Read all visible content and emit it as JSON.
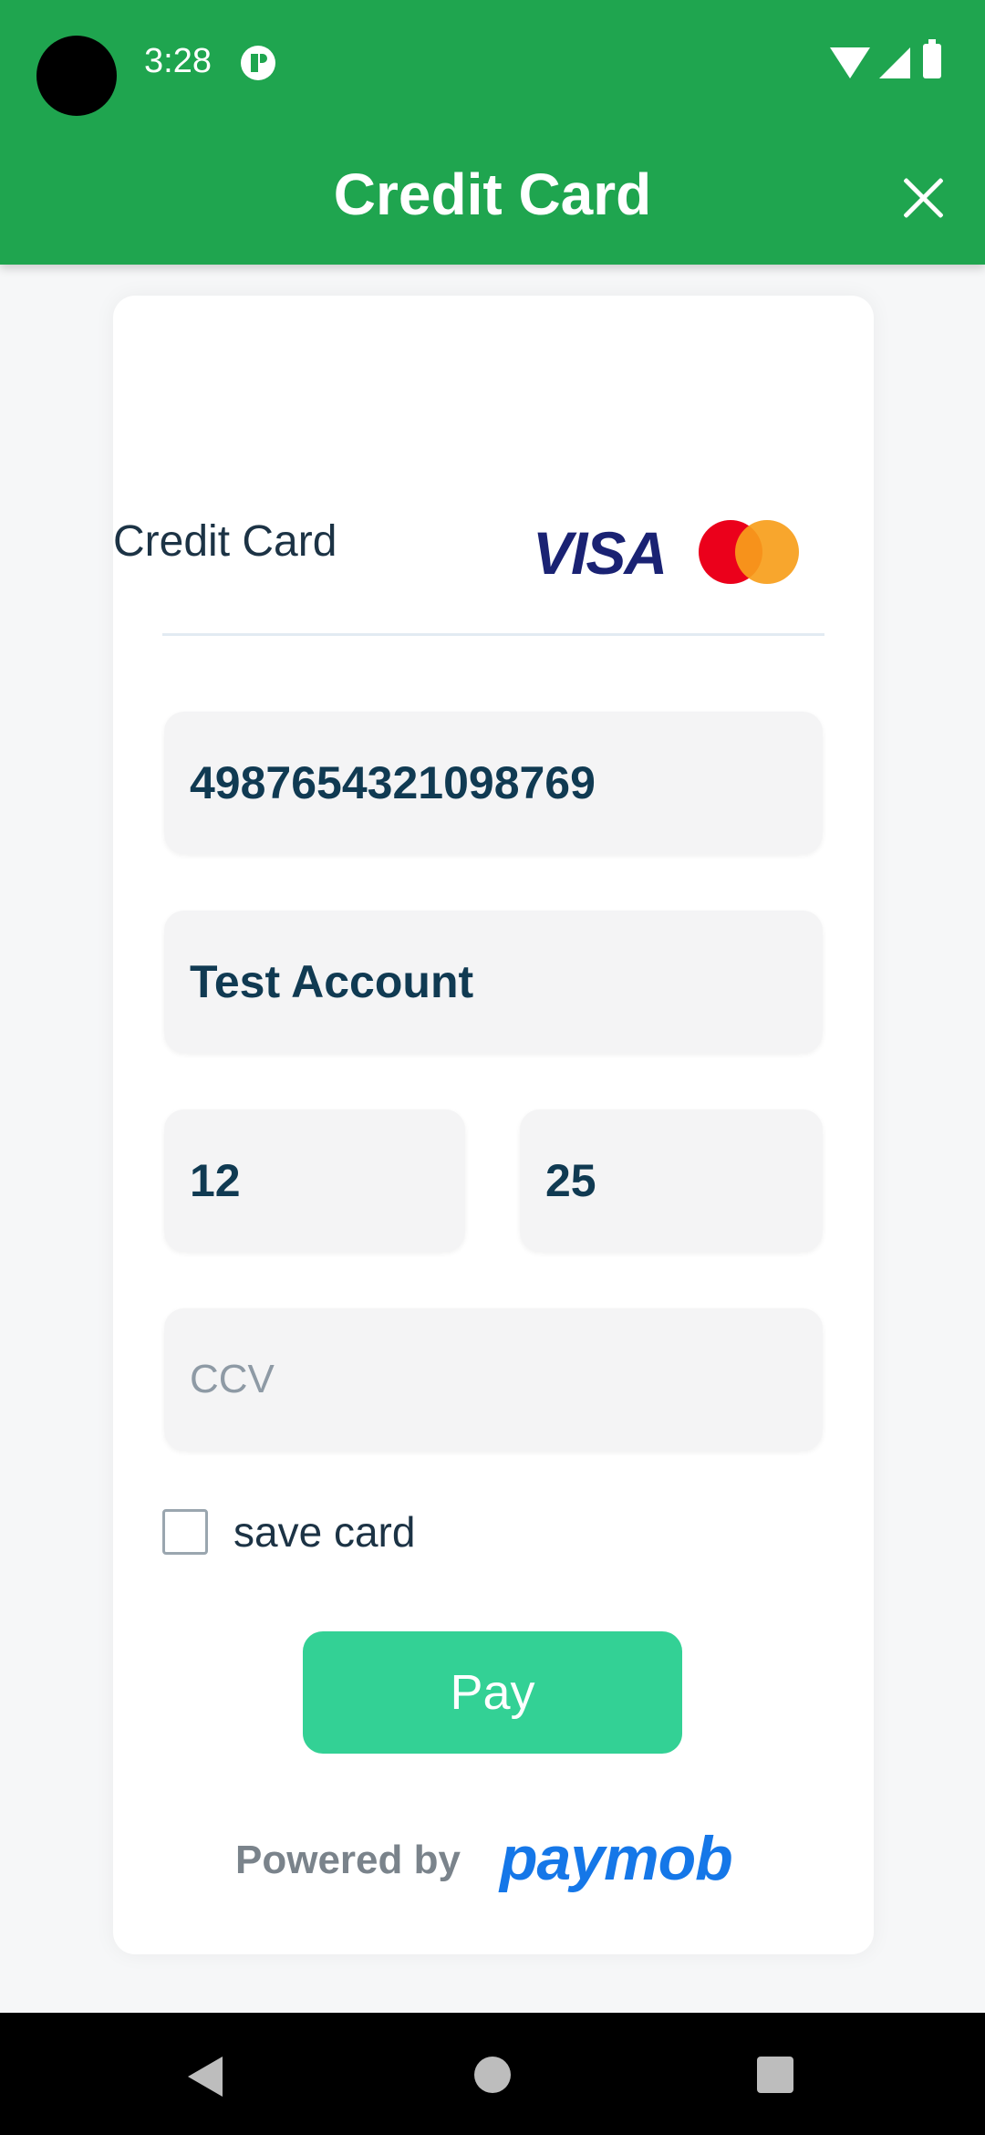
{
  "status_bar": {
    "time": "3:28",
    "icons": [
      "app-notification-icon",
      "wifi-icon",
      "signal-icon",
      "battery-icon"
    ]
  },
  "app_bar": {
    "title": "Credit Card",
    "close_icon": "close-icon",
    "background_color": "#1fa54f"
  },
  "card": {
    "title": "Credit Card",
    "brands": {
      "visa": "VISA",
      "mastercard": "mastercard-logo"
    },
    "fields": {
      "card_number": "4987654321098769",
      "card_holder": "Test Account",
      "expiry_month": "12",
      "expiry_year": "25",
      "ccv_placeholder": "CCV"
    },
    "save_card": {
      "label": "save card",
      "checked": false
    },
    "pay_button": {
      "label": "Pay",
      "color": "#33d195"
    },
    "footer": {
      "powered_by": "Powered by",
      "brand": "paymob"
    }
  },
  "nav_bar": {
    "buttons": [
      "back-icon",
      "home-icon",
      "recents-icon"
    ]
  }
}
